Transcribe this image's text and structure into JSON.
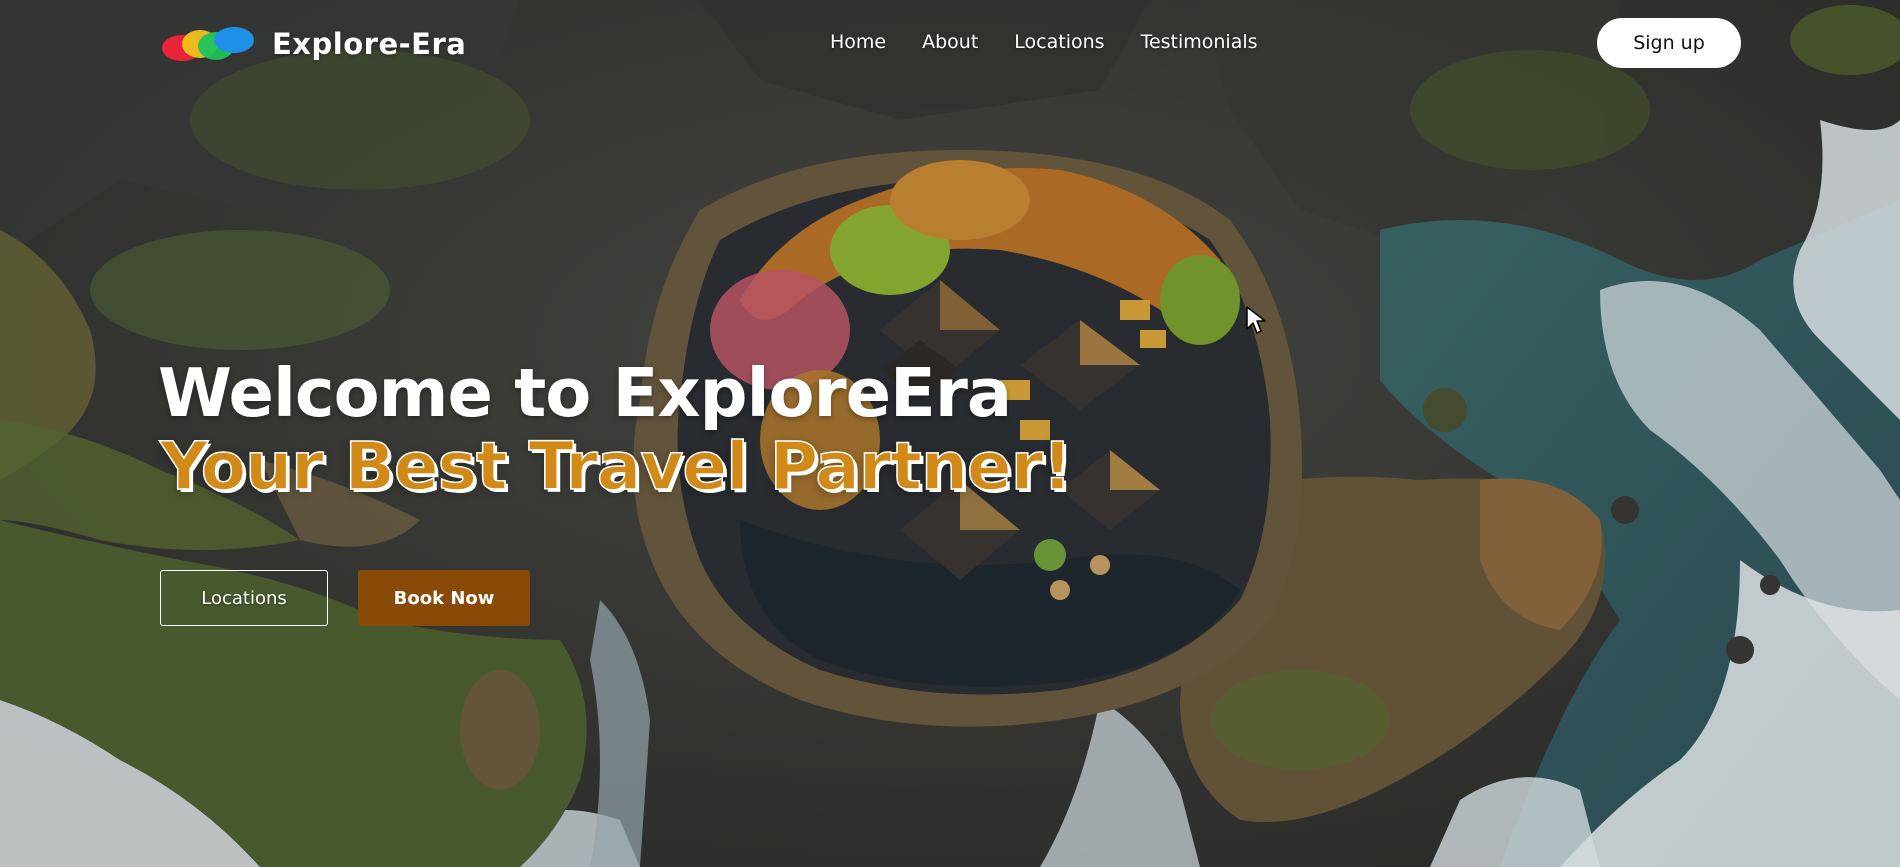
{
  "brand": {
    "name": "Explore-Era",
    "logo_colors": [
      "#e8243a",
      "#f2c21b",
      "#1fc25a",
      "#1e90e8"
    ]
  },
  "nav": {
    "items": [
      {
        "label": "Home"
      },
      {
        "label": "About"
      },
      {
        "label": "Locations"
      },
      {
        "label": "Testimonials"
      }
    ],
    "signup_label": "Sign up"
  },
  "hero": {
    "title": "Welcome to ExploreEra",
    "subtitle": "Your Best Travel Partner!",
    "locations_button": "Locations",
    "book_button": "Book Now"
  },
  "colors": {
    "accent": "#d18a17",
    "book_button_bg": "#8a4a07",
    "white": "#ffffff"
  },
  "icons": [
    "brand-logo-icon",
    "mouse-cursor-icon"
  ]
}
